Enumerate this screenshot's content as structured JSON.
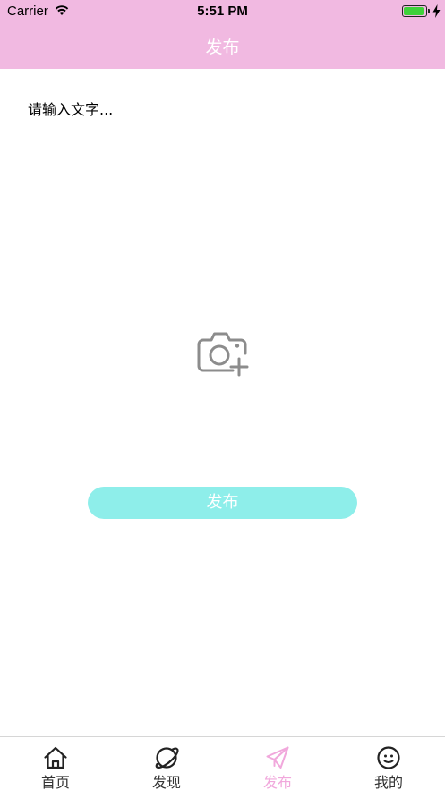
{
  "status_bar": {
    "carrier": "Carrier",
    "time": "5:51 PM",
    "battery_fraction": 0.9,
    "battery_color": "#3fd13a"
  },
  "nav": {
    "title": "发布",
    "background": "#f1b9e1"
  },
  "editor": {
    "placeholder": "请输入文字...",
    "value": ""
  },
  "photo": {
    "icon": "camera-plus-icon"
  },
  "publish_button": {
    "label": "发布",
    "color": "#8eeeea"
  },
  "tabs": [
    {
      "label": "首页",
      "icon": "home-icon",
      "active": false
    },
    {
      "label": "发现",
      "icon": "planet-icon",
      "active": false
    },
    {
      "label": "发布",
      "icon": "paper-plane-icon",
      "active": true
    },
    {
      "label": "我的",
      "icon": "smiley-icon",
      "active": false
    }
  ],
  "active_tab_color": "#f1a8dc"
}
